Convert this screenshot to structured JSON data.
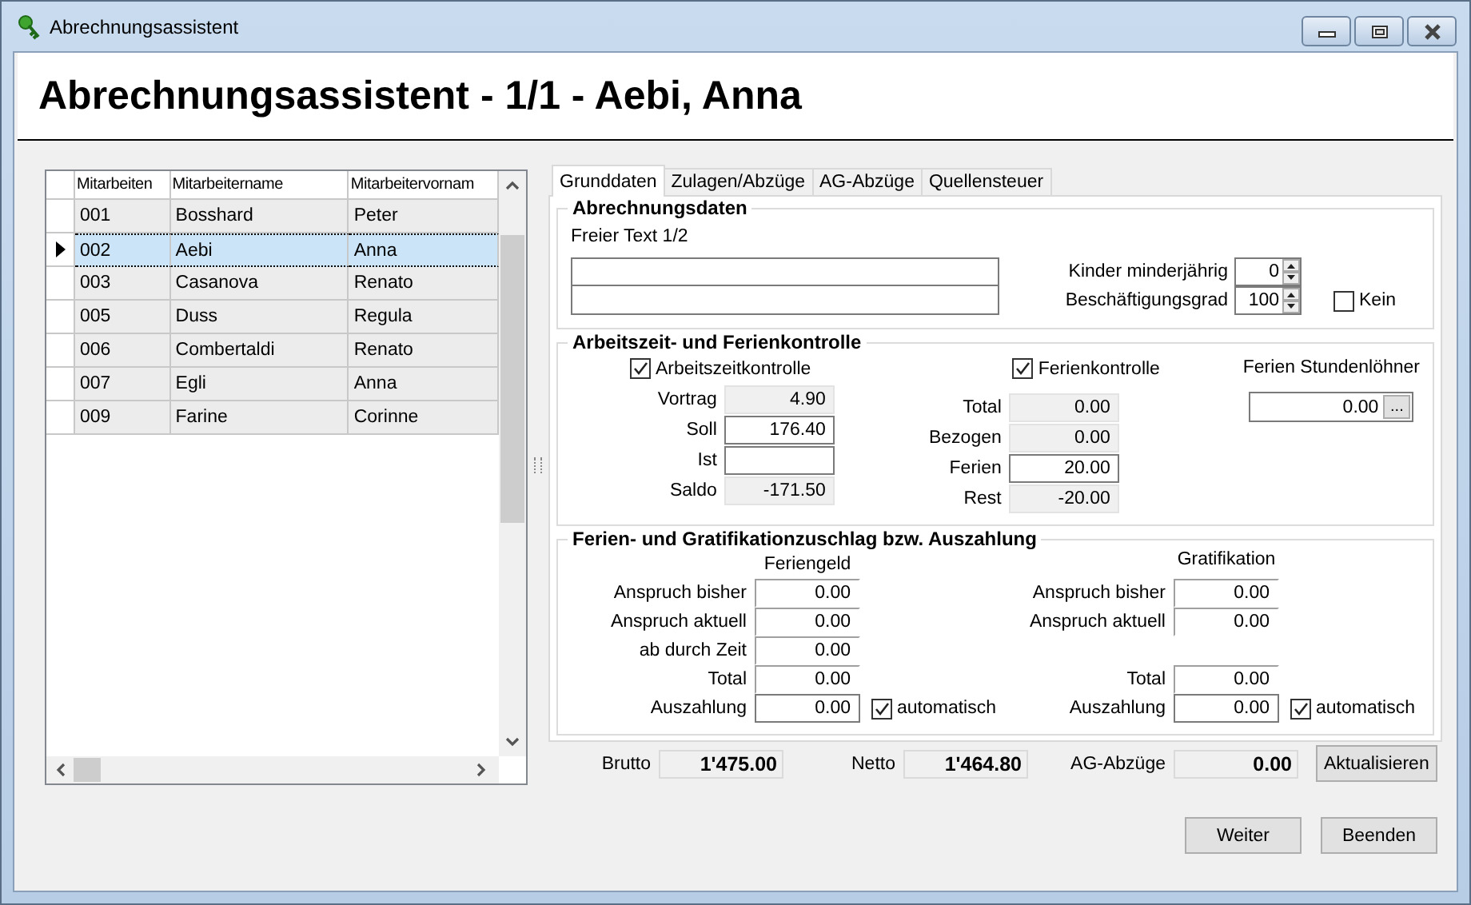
{
  "window": {
    "title": "Abrechnungsassistent"
  },
  "header": {
    "title": "Abrechnungsassistent - 1/1 - Aebi, Anna"
  },
  "employee_table": {
    "columns": [
      "Mitarbeiten",
      "Mitarbeitername",
      "Mitarbeitervornam"
    ],
    "rows": [
      {
        "cells": [
          "001",
          "Bosshard",
          "Peter"
        ],
        "selected": false
      },
      {
        "cells": [
          "002",
          "Aebi",
          "Anna"
        ],
        "selected": true
      },
      {
        "cells": [
          "003",
          "Casanova",
          "Renato"
        ],
        "selected": false
      },
      {
        "cells": [
          "005",
          "Duss",
          "Regula"
        ],
        "selected": false
      },
      {
        "cells": [
          "006",
          "Combertaldi",
          "Renato"
        ],
        "selected": false
      },
      {
        "cells": [
          "007",
          "Egli",
          "Anna"
        ],
        "selected": false
      },
      {
        "cells": [
          "009",
          "Farine",
          "Corinne"
        ],
        "selected": false
      }
    ]
  },
  "tabs": [
    {
      "label": "Grunddaten",
      "selected": true
    },
    {
      "label": "Zulagen/Abzüge",
      "selected": false
    },
    {
      "label": "AG-Abzüge",
      "selected": false
    },
    {
      "label": "Quellensteuer",
      "selected": false
    }
  ],
  "abrechnungsdaten": {
    "title": "Abrechnungsdaten",
    "free_text_label": "Freier Text 1/2",
    "spinners": [
      {
        "label": "Kinder minderjährig",
        "value": "0"
      },
      {
        "label": "Beschäftigungsgrad",
        "value": "100"
      }
    ],
    "kein": {
      "label": "Kein",
      "checked": false
    }
  },
  "kontrolle": {
    "title": "Arbeitszeit- und Ferienkontrolle",
    "columns": [
      {
        "checkbox": {
          "label": "Arbeitszeitkontrolle",
          "checked": true
        },
        "fields": [
          {
            "label": "Vortrag",
            "value": "4.90",
            "readonly": true
          },
          {
            "label": "Soll",
            "value": "176.40",
            "readonly": false
          },
          {
            "label": "Ist",
            "readonly": false
          },
          {
            "label": "Saldo",
            "value": "-171.50",
            "readonly": true
          }
        ]
      },
      {
        "checkbox": {
          "label": "Ferienkontrolle",
          "checked": true
        },
        "fields": [
          {
            "label": "Total",
            "value": "0.00",
            "readonly": true
          },
          {
            "label": "Bezogen",
            "value": "0.00",
            "readonly": true
          },
          {
            "label": "Ferien",
            "value": "20.00",
            "readonly": false
          },
          {
            "label": "Rest",
            "value": "-20.00",
            "readonly": true
          }
        ]
      }
    ],
    "stundenloehner": {
      "label": "Ferien Stundenlöhner",
      "value": "0.00",
      "button": "..."
    }
  },
  "zuschlag": {
    "title": "Ferien- und Gratifikationzuschlag bzw. Auszahlung",
    "columns": [
      {
        "heading": "Feriengeld",
        "rows": [
          {
            "kind": "field",
            "label": "Anspruch bisher",
            "value": "0.00"
          },
          {
            "kind": "field",
            "label": "Anspruch aktuell",
            "value": "0.00"
          },
          {
            "kind": "field",
            "label": "ab durch Zeit",
            "value": "0.00"
          },
          {
            "kind": "field",
            "label": "Total",
            "value": "0.00"
          },
          {
            "kind": "payout",
            "label": "Auszahlung",
            "value": "0.00",
            "auto": {
              "label": "automatisch",
              "checked": true
            }
          }
        ]
      },
      {
        "heading": "Gratifikation",
        "rows": [
          {
            "kind": "field",
            "label": "Anspruch bisher",
            "value": "0.00"
          },
          {
            "kind": "field",
            "label": "Anspruch aktuell",
            "value": "0.00"
          },
          {
            "kind": "empty"
          },
          {
            "kind": "field",
            "label": "Total",
            "value": "0.00"
          },
          {
            "kind": "payout",
            "label": "Auszahlung",
            "value": "0.00",
            "auto": {
              "label": "automatisch",
              "checked": true
            }
          }
        ]
      }
    ]
  },
  "totals": [
    {
      "label": "Brutto",
      "value": "1'475.00"
    },
    {
      "label": "Netto",
      "value": "1'464.80"
    },
    {
      "label": "AG-Abzüge",
      "value": "0.00"
    }
  ],
  "refresh_button": "Aktualisieren",
  "buttons": [
    "Weiter",
    "Beenden"
  ]
}
